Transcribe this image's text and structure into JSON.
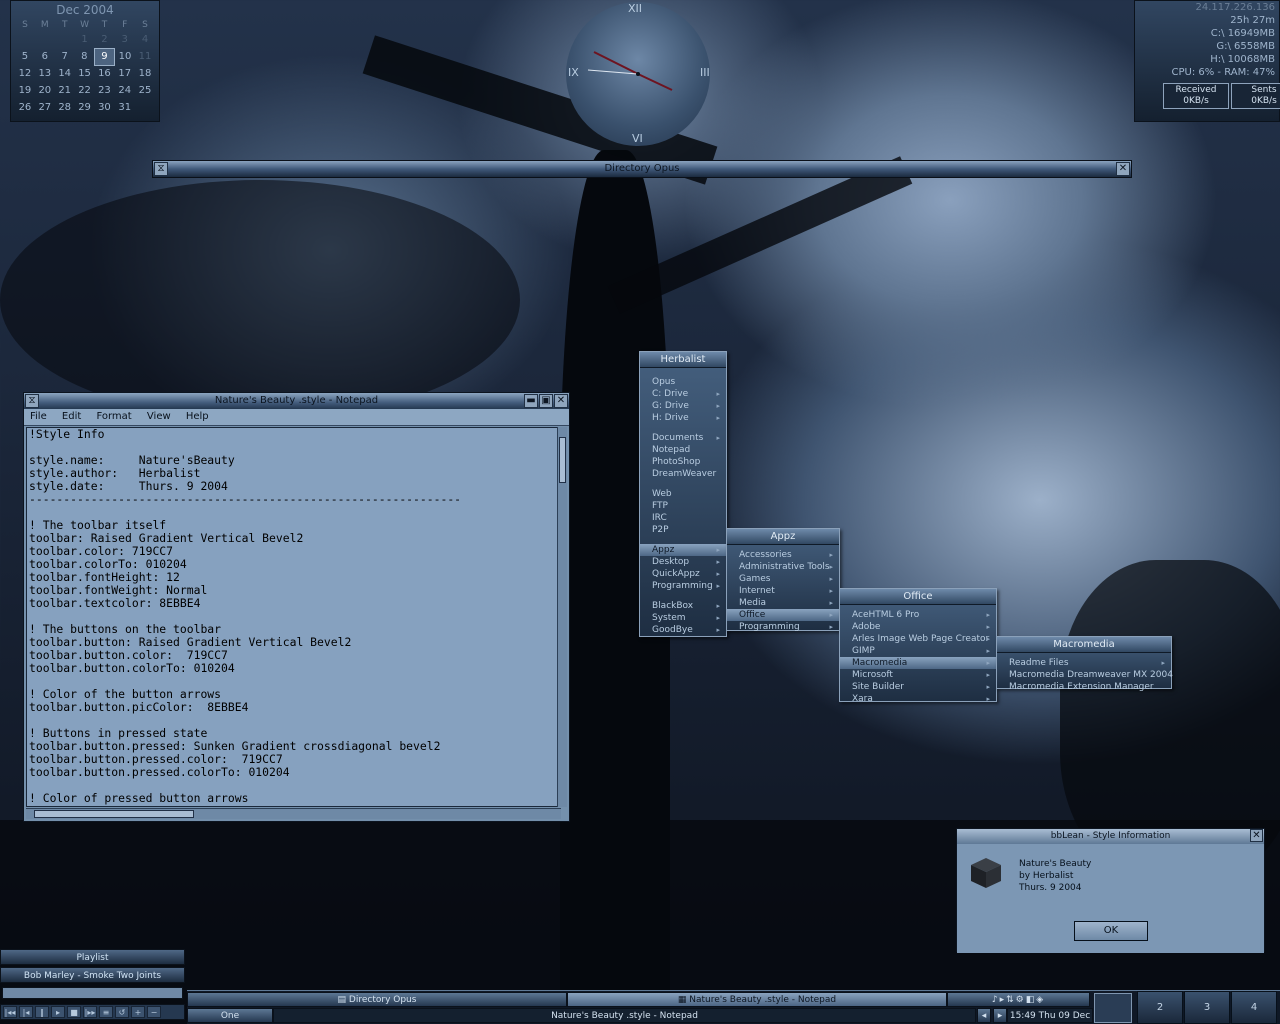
{
  "calendar": {
    "title": "Dec 2004",
    "days": [
      "S",
      "M",
      "T",
      "W",
      "T",
      "F",
      "S"
    ],
    "weeks": [
      [
        "",
        "",
        "",
        "1",
        "2",
        "3",
        "4"
      ],
      [
        "5",
        "6",
        "7",
        "8",
        "9",
        "10",
        "11"
      ],
      [
        "12",
        "13",
        "14",
        "15",
        "16",
        "17",
        "18"
      ],
      [
        "19",
        "20",
        "21",
        "22",
        "23",
        "24",
        "25"
      ],
      [
        "26",
        "27",
        "28",
        "29",
        "30",
        "31",
        ""
      ]
    ],
    "today": "9"
  },
  "clock": {
    "n12": "XII",
    "n3": "III",
    "n6": "VI",
    "n9": "IX"
  },
  "sysmon": {
    "ip": "24.117.226.136",
    "uptime": "25h 27m",
    "drive_c": "C:\\ 16949MB",
    "drive_g": "G:\\ 6558MB",
    "drive_h": "H:\\ 10068MB",
    "cpu_ram": "CPU: 6% - RAM: 47%",
    "received_label": "Received",
    "received_value": "0KB/s",
    "sent_label": "Sents",
    "sent_value": "0KB/s"
  },
  "dopus": {
    "title": "Directory Opus"
  },
  "notepad": {
    "title": "Nature's Beauty .style - Notepad",
    "menus": [
      "File",
      "Edit",
      "Format",
      "View",
      "Help"
    ],
    "content": "!Style Info\n\nstyle.name:     Nature'sBeauty\nstyle.author:   Herbalist\nstyle.date:     Thurs. 9 2004\n---------------------------------------------------------------\n\n! The toolbar itself\ntoolbar: Raised Gradient Vertical Bevel2\ntoolbar.color: 719CC7\ntoolbar.colorTo: 010204\ntoolbar.fontHeight: 12\ntoolbar.fontWeight: Normal\ntoolbar.textcolor: 8EBBE4\n\n! The buttons on the toolbar\ntoolbar.button: Raised Gradient Vertical Bevel2\ntoolbar.button.color:  719CC7\ntoolbar.button.colorTo: 010204\n\n! Color of the button arrows\ntoolbar.button.picColor:  8EBBE4\n\n! Buttons in pressed state\ntoolbar.button.pressed: Sunken Gradient crossdiagonal bevel2\ntoolbar.button.pressed.color:  719CC7\ntoolbar.button.pressed.colorTo: 010204\n\n! Color of pressed button arrows"
  },
  "menu_main": {
    "title": "Herbalist",
    "groups": [
      [
        {
          "label": "Opus",
          "sub": false
        },
        {
          "label": "C: Drive",
          "sub": true
        },
        {
          "label": "G: Drive",
          "sub": true
        },
        {
          "label": "H: Drive",
          "sub": true
        }
      ],
      [
        {
          "label": "Documents",
          "sub": true
        },
        {
          "label": "Notepad",
          "sub": false
        },
        {
          "label": "PhotoShop",
          "sub": false
        },
        {
          "label": "DreamWeaver",
          "sub": false
        }
      ],
      [
        {
          "label": "Web",
          "sub": false
        },
        {
          "label": "FTP",
          "sub": false
        },
        {
          "label": "IRC",
          "sub": false
        },
        {
          "label": "P2P",
          "sub": false
        }
      ],
      [
        {
          "label": "Appz",
          "sub": true,
          "active": true
        },
        {
          "label": "Desktop",
          "sub": true
        },
        {
          "label": "QuickAppz",
          "sub": true
        },
        {
          "label": "Programming",
          "sub": true
        }
      ],
      [
        {
          "label": "BlackBox",
          "sub": true
        },
        {
          "label": "System",
          "sub": true
        },
        {
          "label": "GoodBye",
          "sub": true
        }
      ]
    ]
  },
  "menu_appz": {
    "title": "Appz",
    "items": [
      {
        "label": "Accessories",
        "sub": true
      },
      {
        "label": "Administrative Tools",
        "sub": true
      },
      {
        "label": "Games",
        "sub": true
      },
      {
        "label": "Internet",
        "sub": true
      },
      {
        "label": "Media",
        "sub": true
      },
      {
        "label": "Office",
        "sub": true,
        "active": true
      },
      {
        "label": "Programming",
        "sub": true
      }
    ]
  },
  "menu_office": {
    "title": "Office",
    "items": [
      {
        "label": "AceHTML 6 Pro",
        "sub": true
      },
      {
        "label": "Adobe",
        "sub": true
      },
      {
        "label": "Arles Image Web Page Creator",
        "sub": true
      },
      {
        "label": "GIMP",
        "sub": true
      },
      {
        "label": "Macromedia",
        "sub": true,
        "active": true
      },
      {
        "label": "Microsoft",
        "sub": true
      },
      {
        "label": "Site Builder",
        "sub": true
      },
      {
        "label": "Xara",
        "sub": true
      }
    ]
  },
  "menu_macromedia": {
    "title": "Macromedia",
    "items": [
      {
        "label": "Readme Files",
        "sub": true
      },
      {
        "label": "Macromedia Dreamweaver MX 2004",
        "sub": false
      },
      {
        "label": "Macromedia Extension Manager",
        "sub": false
      }
    ]
  },
  "styleinfo": {
    "title": "bbLean - Style Information",
    "line1": "Nature's Beauty",
    "line2": "by Herbalist",
    "line3": "Thurs. 9 2004",
    "ok": "OK"
  },
  "playlist": {
    "title": "Playlist",
    "track": "Bob Marley - Smoke Two Joints",
    "controls": [
      "|◂◂",
      "|◂",
      "‖",
      "▸",
      "■",
      "|▸▸",
      "≡",
      "↺",
      "+",
      "−"
    ]
  },
  "taskbar": {
    "task1": "Directory Opus",
    "task2": "Nature's Beauty .style - Notepad",
    "workspace_name": "One",
    "active_window": "Nature's Beauty .style - Notepad",
    "clock": "15:49 Thu 09 Dec",
    "workspaces": [
      "2",
      "3",
      "4"
    ]
  }
}
